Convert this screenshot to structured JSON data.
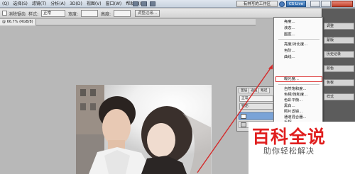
{
  "menubar": {
    "items": [
      "(Q)",
      "选择(S)",
      "滤镜(T)",
      "分析(A)",
      "3D(D)",
      "视图(V)",
      "窗口(W)",
      "帮助(H)"
    ]
  },
  "titlebar": {
    "workspace_label": "有林写的工作区",
    "cs_live_label": "CS Live"
  },
  "optionsbar": {
    "feather_label": "消除锯齿",
    "style_label": "样式:",
    "style_value": "正常",
    "width_label": "宽度:",
    "height_label": "高度:",
    "refine_edge_label": "调整边缘..."
  },
  "document": {
    "tab_label": "@ 66.7% (RGB/8)"
  },
  "adjustments_menu": {
    "items": [
      "亮度...",
      "液态...",
      "图案...",
      "亮度/对比度...",
      "色阶...",
      "曲线...",
      "曝光度...",
      "自然饱和度...",
      "色相/饱和度...",
      "色彩平衡...",
      "黑白...",
      "照片滤镜...",
      "通道混合器...",
      "反相"
    ],
    "highlighted": "曝光度..."
  },
  "layers_panel": {
    "tabs": [
      "图层",
      "通道",
      "路径"
    ],
    "blend_mode": "正常",
    "lock_label": "锁定:"
  },
  "right_panel": {
    "strips": [
      "调整",
      "蒙版",
      "历史记录",
      "颜色",
      "色板",
      "样式"
    ]
  },
  "watermark": {
    "title": "百科全说",
    "subtitle": "助你轻松解决"
  },
  "colors": {
    "accent_red": "#e01f1f",
    "arrow_red": "#d42a2a",
    "panel_gray": "#d6d6d6",
    "workspace_bg": "#b8b8b8"
  }
}
